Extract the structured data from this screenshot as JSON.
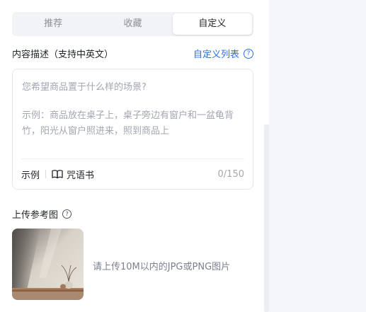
{
  "tabs": [
    {
      "label": "推荐",
      "active": false
    },
    {
      "label": "收藏",
      "active": false
    },
    {
      "label": "自定义",
      "active": true
    }
  ],
  "description": {
    "label": "内容描述（支持中英文）",
    "custom_list_label": "自定义列表",
    "placeholder_question": "您希望商品置于什么样的场景?",
    "placeholder_example": "示例：商品放在桌子上，桌子旁边有窗户和一盆龟背竹，阳光从窗户照进来，照到商品上",
    "example_label": "示例",
    "spell_book_label": "咒语书",
    "counter": "0/150"
  },
  "upload": {
    "label": "上传参考图",
    "hint": "请上传10M以内的JPG或PNG图片"
  },
  "icons": {
    "help": "question-circle-icon",
    "book": "open-book-icon"
  },
  "colors": {
    "accent": "#2a6fe0",
    "placeholder": "#a2a7b0"
  }
}
